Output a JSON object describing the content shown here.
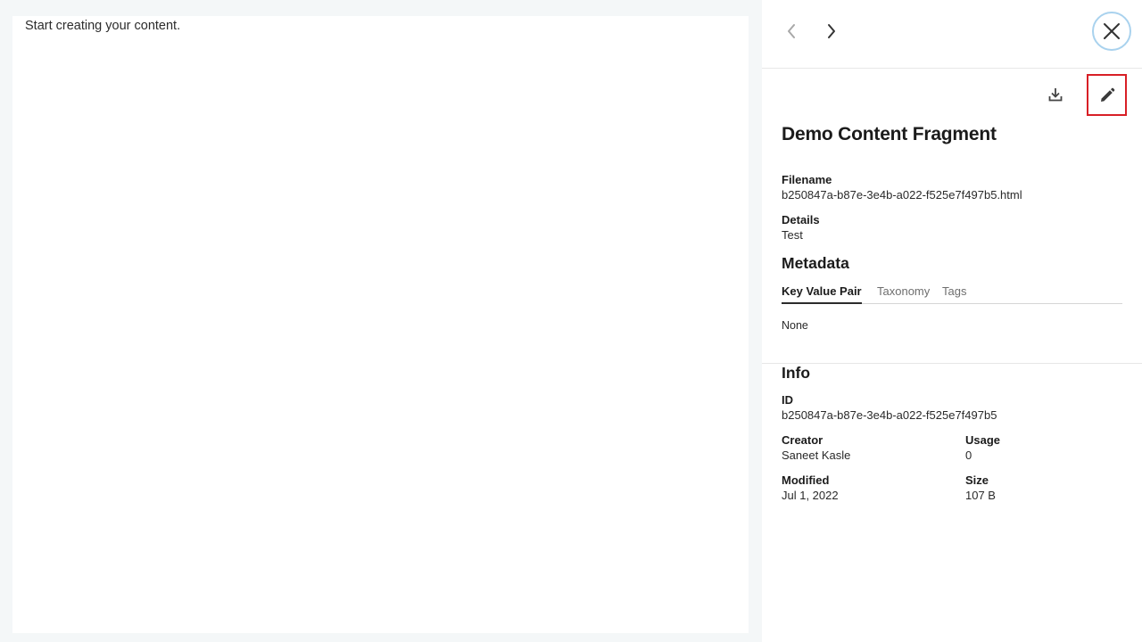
{
  "preview": {
    "placeholder_text": "Start creating your content."
  },
  "nav": {
    "prev_icon": "chevron-left-icon",
    "next_icon": "chevron-right-icon",
    "close_icon": "close-icon"
  },
  "actions": {
    "download_icon": "download-icon",
    "edit_icon": "pencil-icon",
    "highlight_color": "#d81f26"
  },
  "asset": {
    "title": "Demo Content Fragment",
    "filename_label": "Filename",
    "filename": "b250847a-b87e-3e4b-a022-f525e7f497b5.html",
    "details_label": "Details",
    "details": "Test"
  },
  "metadata": {
    "heading": "Metadata",
    "tabs": [
      {
        "label": "Key Value Pair",
        "active": true
      },
      {
        "label": "Taxonomy",
        "active": false
      },
      {
        "label": "Tags",
        "active": false
      }
    ],
    "content": "None"
  },
  "info": {
    "heading": "Info",
    "id_label": "ID",
    "id": "b250847a-b87e-3e4b-a022-f525e7f497b5",
    "creator_label": "Creator",
    "creator": "Saneet Kasle",
    "usage_label": "Usage",
    "usage": "0",
    "modified_label": "Modified",
    "modified": "Jul 1, 2022",
    "size_label": "Size",
    "size": "107 B"
  }
}
